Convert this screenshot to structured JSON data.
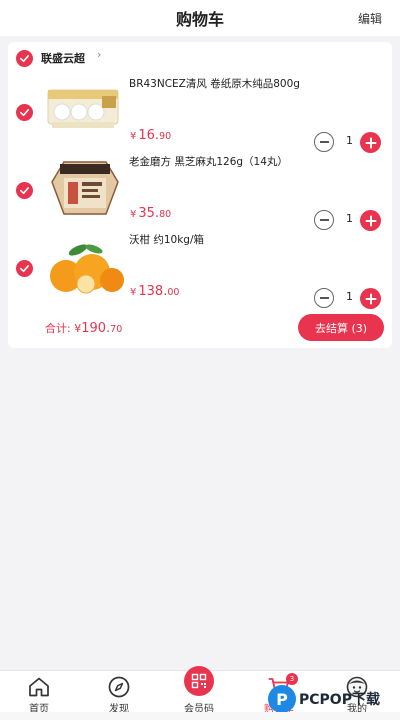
{
  "header": {
    "title": "购物车",
    "edit_label": "编辑"
  },
  "store": {
    "name": "联盛云超",
    "chevron": "›",
    "selected": true
  },
  "items": [
    {
      "name": "BR43NCEZ清风 卷纸原木纯品800g",
      "price_currency": "¥",
      "price_int": "16.",
      "price_frac": "90",
      "quantity": "1",
      "selected": true,
      "image_icon": "toilet-paper-pack-image"
    },
    {
      "name": "老金磨方 黑芝麻丸126g（14丸）",
      "price_currency": "¥",
      "price_int": "35.",
      "price_frac": "80",
      "quantity": "1",
      "selected": true,
      "image_icon": "sesame-balls-box-image"
    },
    {
      "name": "沃柑 约10kg/箱",
      "price_currency": "¥",
      "price_int": "138.",
      "price_frac": "00",
      "quantity": "1",
      "selected": true,
      "image_icon": "oranges-image"
    }
  ],
  "footer": {
    "total_label": "合计:",
    "total_currency": "¥",
    "total_int": "190.",
    "total_frac": "70",
    "checkout_label": "去结算 (3)"
  },
  "tabbar": {
    "tabs": [
      {
        "label": "首页",
        "icon": "home-icon"
      },
      {
        "label": "发现",
        "icon": "compass-icon"
      },
      {
        "label": "会员码",
        "icon": "qr-code-icon"
      },
      {
        "label": "购物车",
        "icon": "cart-icon",
        "active": true,
        "badge": "3"
      },
      {
        "label": "我的",
        "icon": "profile-icon"
      }
    ]
  },
  "watermark": {
    "mark": "P",
    "text": "PCPOP下载"
  },
  "colors": {
    "accent": "#e8344e",
    "background": "#f3f3f5",
    "card": "#ffffff"
  }
}
